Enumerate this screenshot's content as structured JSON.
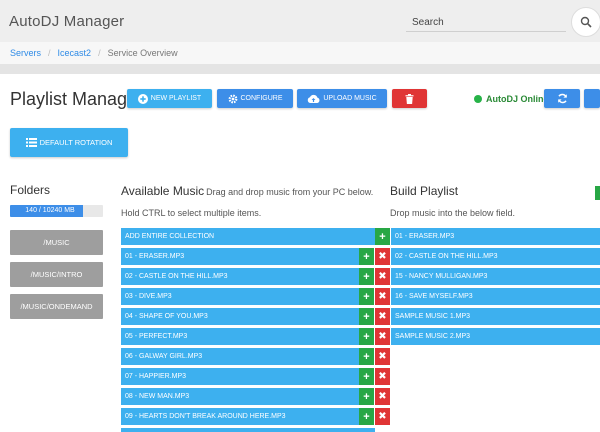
{
  "app": {
    "title": "AutoDJ Manager"
  },
  "search": {
    "placeholder": "Search"
  },
  "breadcrumb": [
    "Servers",
    "Icecast2",
    "Service Overview"
  ],
  "page": {
    "title": "Playlist Manager"
  },
  "toolbar": {
    "new_playlist": "NEW PLAYLIST",
    "configure": "CONFIGURE",
    "upload_music": "UPLOAD MUSIC",
    "status": "AutoDJ Online"
  },
  "default_rotation": "DEFAULT ROTATION",
  "folders": {
    "title": "Folders",
    "storage": {
      "text": "140 / 10240 MB",
      "fill_percent": 79
    },
    "items": [
      "/MUSIC",
      "/MUSIC/INTRO",
      "/MUSIC/ONDEMAND"
    ]
  },
  "available": {
    "title": "Available Music",
    "subtitle": "Drag and drop music from your PC below.",
    "hint": "Hold CTRL to select multiple items.",
    "collection": "ADD ENTIRE COLLECTION",
    "items": [
      "01 - ERASER.MP3",
      "02 - CASTLE ON THE HILL.MP3",
      "03 - DIVE.MP3",
      "04 - SHAPE OF YOU.MP3",
      "05 - PERFECT.MP3",
      "06 - GALWAY GIRL.MP3",
      "07 - HAPPIER.MP3",
      "08 - NEW MAN.MP3",
      "09 - HEARTS DON'T BREAK AROUND HERE.MP3"
    ]
  },
  "build": {
    "title": "Build Playlist",
    "hint": "Drop music into the below field.",
    "items": [
      "01 - ERASER.MP3",
      "02 - CASTLE ON THE HILL.MP3",
      "15 - NANCY MULLIGAN.MP3",
      "16 - SAVE MYSELF.MP3",
      "SAMPLE MUSIC 1.MP3",
      "SAMPLE MUSIC 2.MP3"
    ]
  },
  "colors": {
    "blue": "#3db0ef",
    "dark_blue": "#3d8ee8",
    "red": "#e03535",
    "green": "#28a745",
    "folder_gray": "#9e9e9e"
  }
}
